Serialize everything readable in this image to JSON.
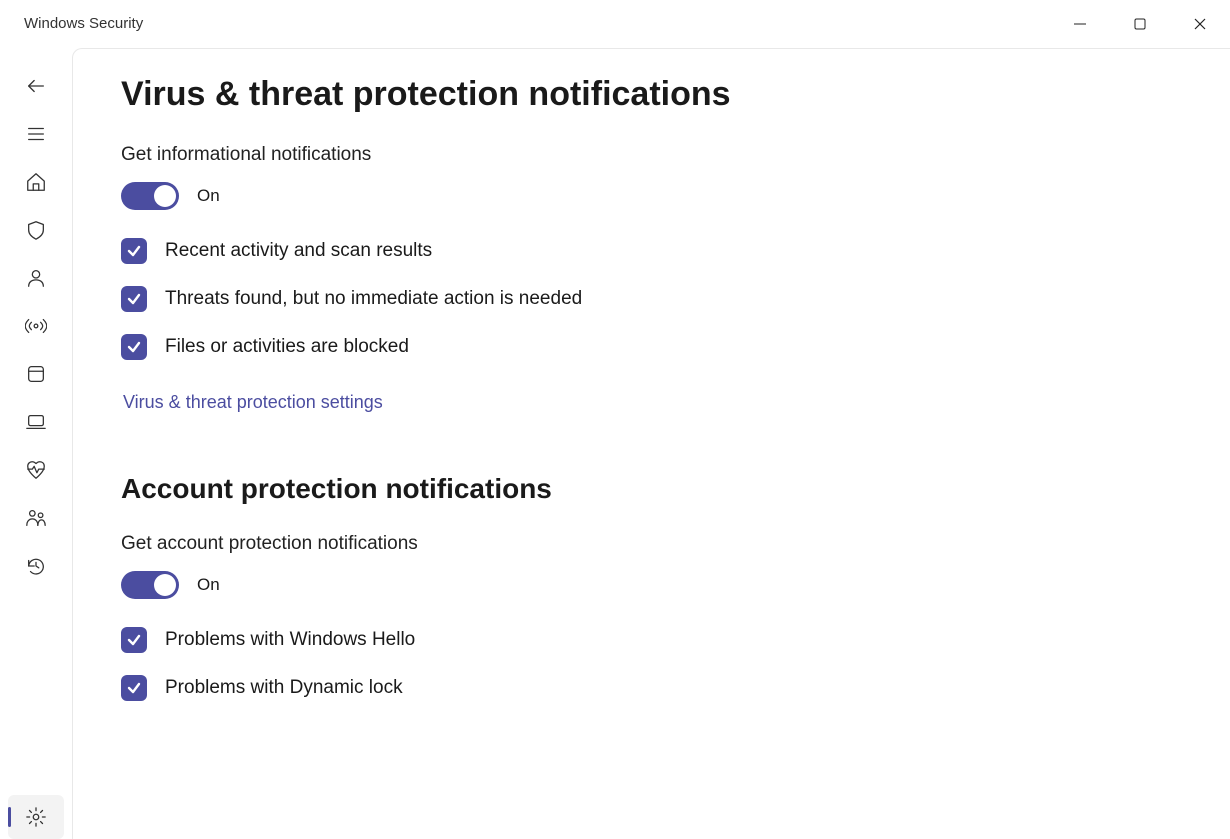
{
  "window": {
    "title": "Windows Security"
  },
  "page": {
    "title": "Virus & threat protection notifications"
  },
  "sections": {
    "virus": {
      "sub_label": "Get informational notifications",
      "toggle_state": "On",
      "checks": [
        "Recent activity and scan results",
        "Threats found, but no immediate action is needed",
        "Files or activities are blocked"
      ],
      "link": "Virus & threat protection settings"
    },
    "account": {
      "title": "Account protection notifications",
      "sub_label": "Get account protection notifications",
      "toggle_state": "On",
      "checks": [
        "Problems with Windows Hello",
        "Problems with Dynamic lock"
      ]
    }
  }
}
